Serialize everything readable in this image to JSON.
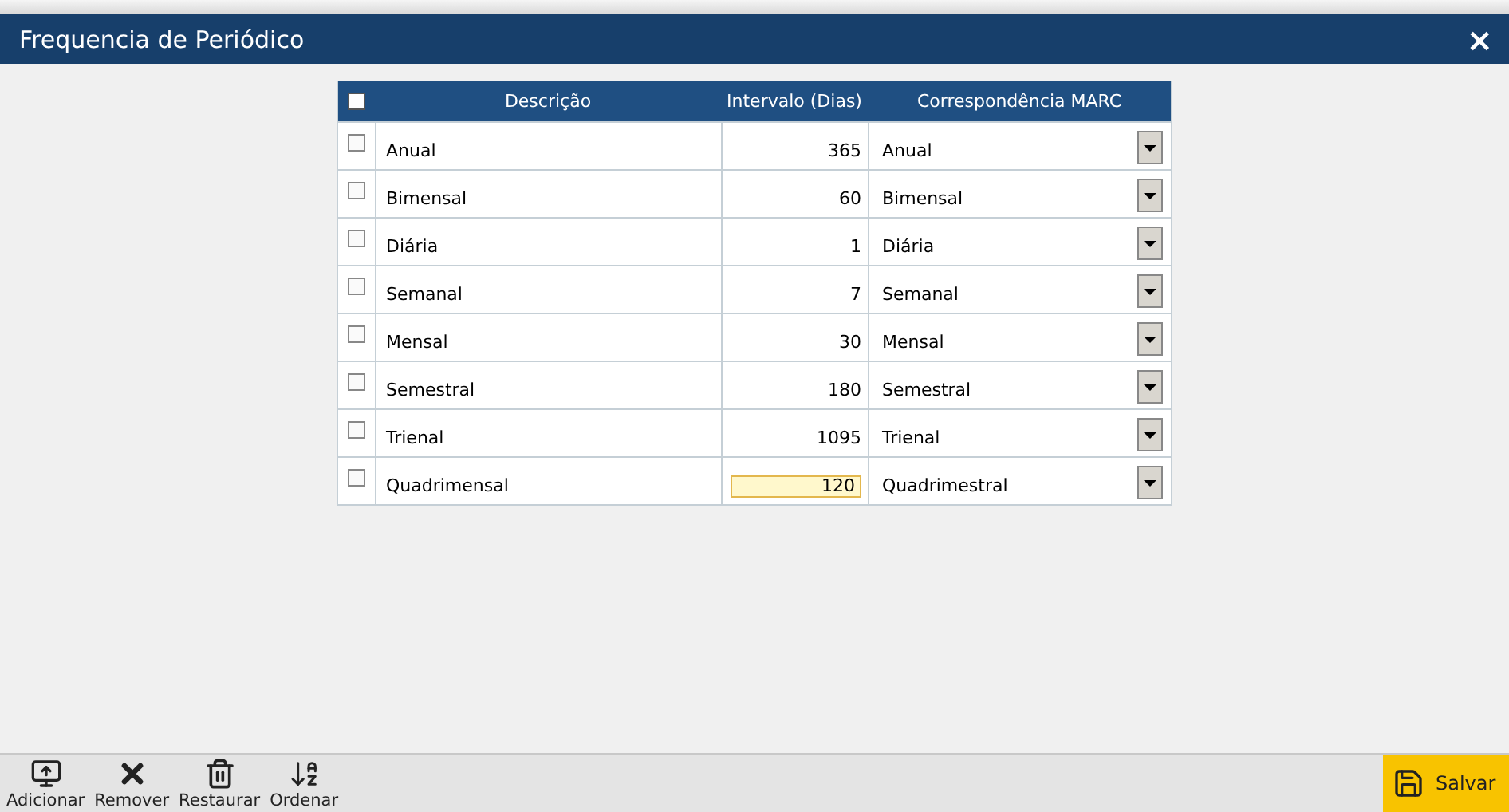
{
  "window": {
    "title": "Frequencia de Periódico",
    "close": "×"
  },
  "table": {
    "select_all": {
      "checked": false
    },
    "columns": [
      "Descrição",
      "Intervalo (Dias)",
      "Correspondência MARC"
    ],
    "rows": [
      {
        "checked": false,
        "description": "Anual",
        "interval": "365",
        "editing": false,
        "marc": "Anual"
      },
      {
        "checked": false,
        "description": "Bimensal",
        "interval": "60",
        "editing": false,
        "marc": "Bimensal"
      },
      {
        "checked": false,
        "description": "Diária",
        "interval": "1",
        "editing": false,
        "marc": "Diária"
      },
      {
        "checked": false,
        "description": "Semanal",
        "interval": "7",
        "editing": false,
        "marc": "Semanal"
      },
      {
        "checked": false,
        "description": "Mensal",
        "interval": "30",
        "editing": false,
        "marc": "Mensal"
      },
      {
        "checked": false,
        "description": "Semestral",
        "interval": "180",
        "editing": false,
        "marc": "Semestral"
      },
      {
        "checked": false,
        "description": "Trienal",
        "interval": "1095",
        "editing": false,
        "marc": "Trienal"
      },
      {
        "checked": false,
        "description": "Quadrimensal",
        "interval": "120",
        "editing": true,
        "marc": "Quadrimestral"
      }
    ]
  },
  "toolbar": [
    {
      "kind": "add",
      "label": "Adicionar"
    },
    {
      "kind": "remove",
      "label": "Remover"
    },
    {
      "kind": "restore",
      "label": "Restaurar"
    },
    {
      "kind": "sort",
      "label": "Ordenar"
    }
  ],
  "save_button": {
    "label": "Salvar"
  }
}
